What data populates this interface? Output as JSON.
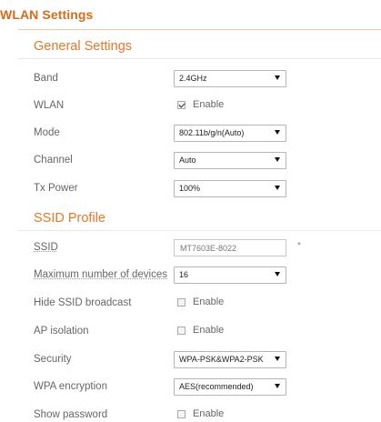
{
  "page": {
    "title": "WLAN Settings"
  },
  "general": {
    "heading": "General Settings",
    "band": {
      "label": "Band",
      "value": "2.4GHz"
    },
    "wlan": {
      "label": "WLAN",
      "checkbox_label": "Enable",
      "checked": true
    },
    "mode": {
      "label": "Mode",
      "value": "802.11b/g/n(Auto)"
    },
    "channel": {
      "label": "Channel",
      "value": "Auto"
    },
    "tx_power": {
      "label": "Tx Power",
      "value": "100%"
    }
  },
  "ssid_profile": {
    "heading": "SSID Profile",
    "ssid": {
      "label": "SSID",
      "value": "MT7603E-8022",
      "required_mark": "*"
    },
    "max_devices": {
      "label": "Maximum number of devices",
      "value": "16"
    },
    "hide_ssid": {
      "label": "Hide SSID broadcast",
      "checkbox_label": "Enable",
      "checked": false
    },
    "ap_isolation": {
      "label": "AP isolation",
      "checkbox_label": "Enable",
      "checked": false
    },
    "security": {
      "label": "Security",
      "value": "WPA-PSK&WPA2-PSK"
    },
    "wpa_encryption": {
      "label": "WPA encryption",
      "value": "AES(recommended)"
    },
    "show_password": {
      "label": "Show password",
      "checkbox_label": "Enable",
      "checked": false
    }
  },
  "colors": {
    "accent": "#e0782a",
    "title": "#d96a1b"
  }
}
